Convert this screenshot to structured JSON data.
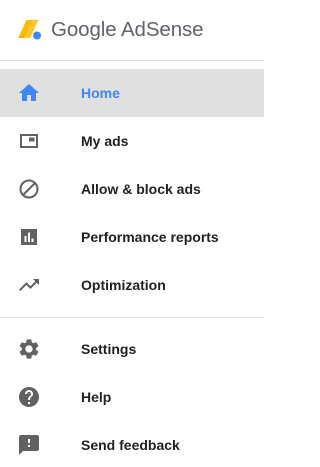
{
  "brand": {
    "name": "Google AdSense",
    "icon": "adsense-logo-icon"
  },
  "colors": {
    "accent": "#4285f4",
    "active_bg": "#e0e0e0",
    "icon": "#616161",
    "text": "#212121"
  },
  "nav": {
    "primary": [
      {
        "label": "Home",
        "icon": "home-icon",
        "active": true
      },
      {
        "label": "My ads",
        "icon": "ad-units-icon",
        "active": false
      },
      {
        "label": "Allow & block ads",
        "icon": "block-icon",
        "active": false
      },
      {
        "label": "Performance reports",
        "icon": "bar-chart-icon",
        "active": false
      },
      {
        "label": "Optimization",
        "icon": "trending-up-icon",
        "active": false
      }
    ],
    "secondary": [
      {
        "label": "Settings",
        "icon": "gear-icon"
      },
      {
        "label": "Help",
        "icon": "help-icon"
      },
      {
        "label": "Send feedback",
        "icon": "feedback-icon"
      }
    ]
  }
}
